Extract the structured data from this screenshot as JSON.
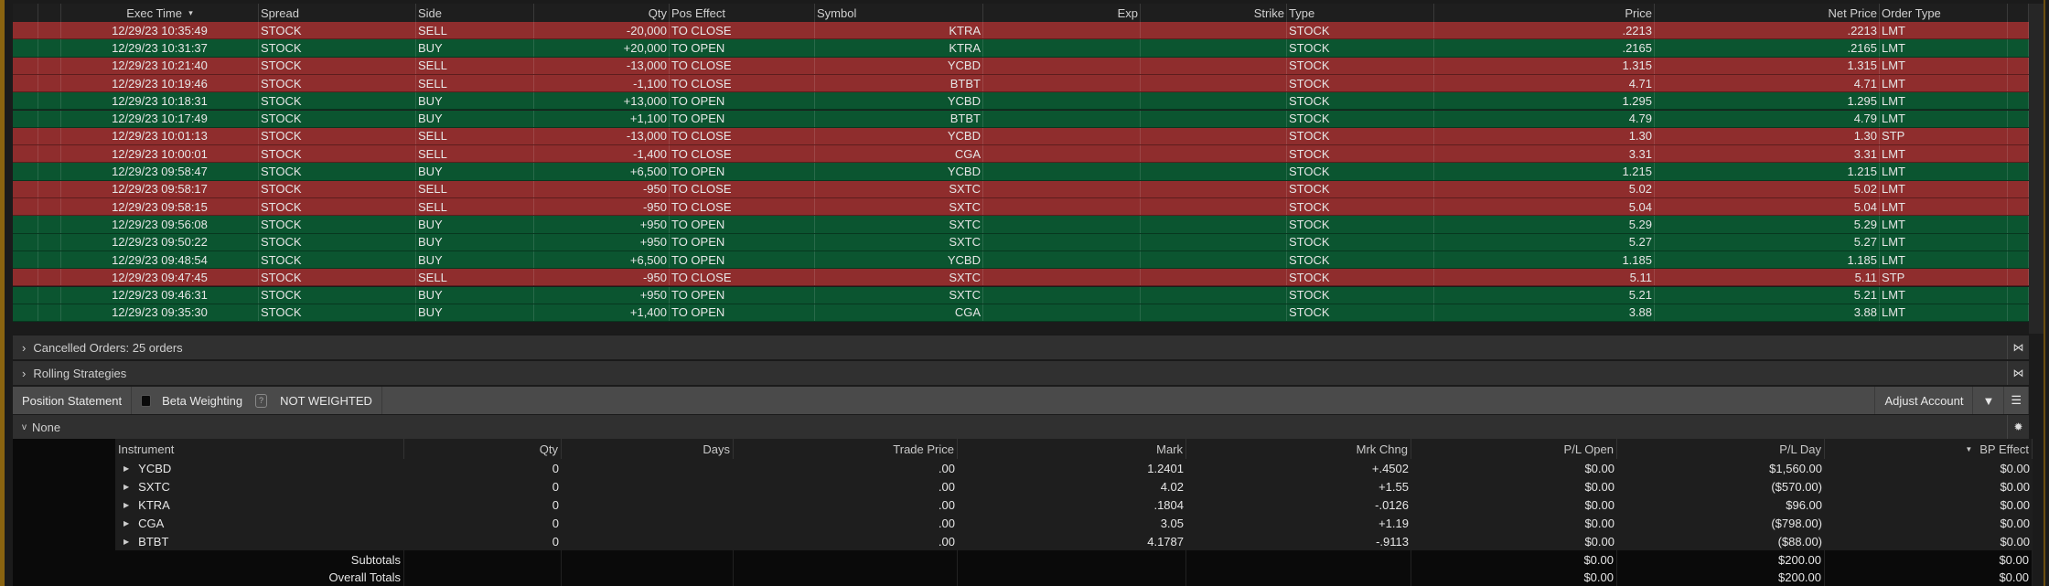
{
  "orders": {
    "headers": {
      "exec_time": "Exec Time",
      "spread": "Spread",
      "side": "Side",
      "qty": "Qty",
      "pos_effect": "Pos Effect",
      "symbol": "Symbol",
      "exp": "Exp",
      "strike": "Strike",
      "type": "Type",
      "price": "Price",
      "net_price": "Net Price",
      "order_type": "Order Type"
    },
    "sort_indicator": "▾",
    "rows": [
      {
        "time": "12/29/23 10:35:49",
        "spread": "STOCK",
        "side": "SELL",
        "qty": "-20,000",
        "pos": "TO CLOSE",
        "symbol": "KTRA",
        "type": "STOCK",
        "price": ".2213",
        "net": ".2213",
        "otype": "LMT"
      },
      {
        "time": "12/29/23 10:31:37",
        "spread": "STOCK",
        "side": "BUY",
        "qty": "+20,000",
        "pos": "TO OPEN",
        "symbol": "KTRA",
        "type": "STOCK",
        "price": ".2165",
        "net": ".2165",
        "otype": "LMT"
      },
      {
        "time": "12/29/23 10:21:40",
        "spread": "STOCK",
        "side": "SELL",
        "qty": "-13,000",
        "pos": "TO CLOSE",
        "symbol": "YCBD",
        "type": "STOCK",
        "price": "1.315",
        "net": "1.315",
        "otype": "LMT"
      },
      {
        "time": "12/29/23 10:19:46",
        "spread": "STOCK",
        "side": "SELL",
        "qty": "-1,100",
        "pos": "TO CLOSE",
        "symbol": "BTBT",
        "type": "STOCK",
        "price": "4.71",
        "net": "4.71",
        "otype": "LMT"
      },
      {
        "time": "12/29/23 10:18:31",
        "spread": "STOCK",
        "side": "BUY",
        "qty": "+13,000",
        "pos": "TO OPEN",
        "symbol": "YCBD",
        "type": "STOCK",
        "price": "1.295",
        "net": "1.295",
        "otype": "LMT"
      },
      {
        "time": "12/29/23 10:17:49",
        "spread": "STOCK",
        "side": "BUY",
        "qty": "+1,100",
        "pos": "TO OPEN",
        "symbol": "BTBT",
        "type": "STOCK",
        "price": "4.79",
        "net": "4.79",
        "otype": "LMT"
      },
      {
        "time": "12/29/23 10:01:13",
        "spread": "STOCK",
        "side": "SELL",
        "qty": "-13,000",
        "pos": "TO CLOSE",
        "symbol": "YCBD",
        "type": "STOCK",
        "price": "1.30",
        "net": "1.30",
        "otype": "STP"
      },
      {
        "time": "12/29/23 10:00:01",
        "spread": "STOCK",
        "side": "SELL",
        "qty": "-1,400",
        "pos": "TO CLOSE",
        "symbol": "CGA",
        "type": "STOCK",
        "price": "3.31",
        "net": "3.31",
        "otype": "LMT"
      },
      {
        "time": "12/29/23 09:58:47",
        "spread": "STOCK",
        "side": "BUY",
        "qty": "+6,500",
        "pos": "TO OPEN",
        "symbol": "YCBD",
        "type": "STOCK",
        "price": "1.215",
        "net": "1.215",
        "otype": "LMT"
      },
      {
        "time": "12/29/23 09:58:17",
        "spread": "STOCK",
        "side": "SELL",
        "qty": "-950",
        "pos": "TO CLOSE",
        "symbol": "SXTC",
        "type": "STOCK",
        "price": "5.02",
        "net": "5.02",
        "otype": "LMT"
      },
      {
        "time": "12/29/23 09:58:15",
        "spread": "STOCK",
        "side": "SELL",
        "qty": "-950",
        "pos": "TO CLOSE",
        "symbol": "SXTC",
        "type": "STOCK",
        "price": "5.04",
        "net": "5.04",
        "otype": "LMT"
      },
      {
        "time": "12/29/23 09:56:08",
        "spread": "STOCK",
        "side": "BUY",
        "qty": "+950",
        "pos": "TO OPEN",
        "symbol": "SXTC",
        "type": "STOCK",
        "price": "5.29",
        "net": "5.29",
        "otype": "LMT"
      },
      {
        "time": "12/29/23 09:50:22",
        "spread": "STOCK",
        "side": "BUY",
        "qty": "+950",
        "pos": "TO OPEN",
        "symbol": "SXTC",
        "type": "STOCK",
        "price": "5.27",
        "net": "5.27",
        "otype": "LMT"
      },
      {
        "time": "12/29/23 09:48:54",
        "spread": "STOCK",
        "side": "BUY",
        "qty": "+6,500",
        "pos": "TO OPEN",
        "symbol": "YCBD",
        "type": "STOCK",
        "price": "1.185",
        "net": "1.185",
        "otype": "LMT"
      },
      {
        "time": "12/29/23 09:47:45",
        "spread": "STOCK",
        "side": "SELL",
        "qty": "-950",
        "pos": "TO CLOSE",
        "symbol": "SXTC",
        "type": "STOCK",
        "price": "5.11",
        "net": "5.11",
        "otype": "STP"
      },
      {
        "time": "12/29/23 09:46:31",
        "spread": "STOCK",
        "side": "BUY",
        "qty": "+950",
        "pos": "TO OPEN",
        "symbol": "SXTC",
        "type": "STOCK",
        "price": "5.21",
        "net": "5.21",
        "otype": "LMT"
      },
      {
        "time": "12/29/23 09:35:30",
        "spread": "STOCK",
        "side": "BUY",
        "qty": "+1,400",
        "pos": "TO OPEN",
        "symbol": "CGA",
        "type": "STOCK",
        "price": "3.88",
        "net": "3.88",
        "otype": "LMT"
      }
    ]
  },
  "sections": {
    "cancelled": "Cancelled Orders: 25 orders",
    "rolling": "Rolling Strategies"
  },
  "position_bar": {
    "title": "Position Statement",
    "beta": "Beta Weighting",
    "beta_value": "NOT WEIGHTED",
    "help_glyph": "?",
    "adjust": "Adjust Account"
  },
  "group": {
    "label": "None"
  },
  "positions": {
    "headers": {
      "instrument": "Instrument",
      "qty": "Qty",
      "days": "Days",
      "trade_price": "Trade Price",
      "mark": "Mark",
      "mrk_chng": "Mrk Chng",
      "pl_open": "P/L Open",
      "pl_day": "P/L Day",
      "bp_effect": "BP Effect"
    },
    "rows": [
      {
        "sym": "YCBD",
        "qty": "0",
        "trade": ".00",
        "mark": "1.2401",
        "chg": "+.4502",
        "plo": "$0.00",
        "pld": "$1,560.00",
        "bp": "$0.00"
      },
      {
        "sym": "SXTC",
        "qty": "0",
        "trade": ".00",
        "mark": "4.02",
        "chg": "+1.55",
        "plo": "$0.00",
        "pld": "($570.00)",
        "bp": "$0.00"
      },
      {
        "sym": "KTRA",
        "qty": "0",
        "trade": ".00",
        "mark": ".1804",
        "chg": "-.0126",
        "plo": "$0.00",
        "pld": "$96.00",
        "bp": "$0.00"
      },
      {
        "sym": "CGA",
        "qty": "0",
        "trade": ".00",
        "mark": "3.05",
        "chg": "+1.19",
        "plo": "$0.00",
        "pld": "($798.00)",
        "bp": "$0.00"
      },
      {
        "sym": "BTBT",
        "qty": "0",
        "trade": ".00",
        "mark": "4.1787",
        "chg": "-.9113",
        "plo": "$0.00",
        "pld": "($88.00)",
        "bp": "$0.00"
      }
    ],
    "subtotals": {
      "label": "Subtotals",
      "plo": "$0.00",
      "pld": "$200.00",
      "bp": "$0.00"
    },
    "overall": {
      "label": "Overall Totals",
      "plo": "$0.00",
      "pld": "$200.00",
      "bp": "$0.00"
    }
  },
  "colors": {
    "sell": "#8f2d2d",
    "buy": "#0b5530"
  }
}
